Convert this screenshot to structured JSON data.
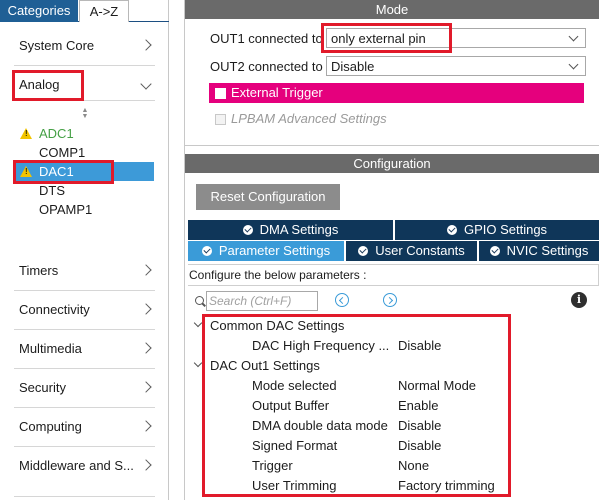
{
  "sidebar": {
    "tabs": {
      "categories": "Categories",
      "az": "A->Z"
    },
    "categories": [
      {
        "label": "System Core"
      },
      {
        "label": "Analog"
      },
      {
        "label": "Timers"
      },
      {
        "label": "Connectivity"
      },
      {
        "label": "Multimedia"
      },
      {
        "label": "Security"
      },
      {
        "label": "Computing"
      },
      {
        "label": "Middleware and S..."
      }
    ],
    "analog_peripherals": [
      {
        "label": "ADC1",
        "warning": true
      },
      {
        "label": "COMP1",
        "warning": false
      },
      {
        "label": "DAC1",
        "warning": true,
        "selected": true
      },
      {
        "label": "DTS",
        "warning": false
      },
      {
        "label": "OPAMP1",
        "warning": false
      }
    ]
  },
  "mode": {
    "header": "Mode",
    "out1_label": "OUT1 connected to",
    "out1_value": "only external pin",
    "out2_label": "OUT2 connected to",
    "out2_value": "Disable",
    "external_trigger_label": "External Trigger",
    "external_trigger_checked": false,
    "lpbam_label": "LPBAM Advanced Settings",
    "lpbam_checked": false
  },
  "configuration": {
    "header": "Configuration",
    "reset_button": "Reset Configuration",
    "tabs_row1": [
      {
        "label": "DMA Settings"
      },
      {
        "label": "GPIO Settings"
      }
    ],
    "tabs_row2": [
      {
        "label": "Parameter Settings",
        "active": true
      },
      {
        "label": "User Constants"
      },
      {
        "label": "NVIC Settings"
      }
    ],
    "description": "Configure the below parameters :",
    "search_placeholder": "Search (Ctrl+F)",
    "groups": [
      {
        "title": "Common DAC Settings",
        "params": [
          {
            "name": "DAC High Frequency ...",
            "value": "Disable"
          }
        ]
      },
      {
        "title": "DAC Out1 Settings",
        "params": [
          {
            "name": "Mode selected",
            "value": "Normal Mode"
          },
          {
            "name": "Output Buffer",
            "value": "Enable"
          },
          {
            "name": "DMA double data mode",
            "value": "Disable"
          },
          {
            "name": "Signed Format",
            "value": "Disable"
          },
          {
            "name": "Trigger",
            "value": "None"
          },
          {
            "name": "User Trimming",
            "value": "Factory trimming"
          }
        ]
      }
    ]
  },
  "colors": {
    "category_tab_active": "#1f5f95",
    "selected_peripheral": "#3d9ad8",
    "external_trigger_bg": "#e5007d",
    "tab_dark": "#0f3659",
    "tab_active": "#3a9bd8",
    "highlight_box": "#e11a2a",
    "warning": "#f2c400"
  },
  "icons": [
    "chevron-right-icon",
    "chevron-down-icon",
    "warning-icon",
    "search-icon",
    "prev-arrow-icon",
    "next-arrow-icon",
    "info-icon",
    "check-circle-icon"
  ]
}
